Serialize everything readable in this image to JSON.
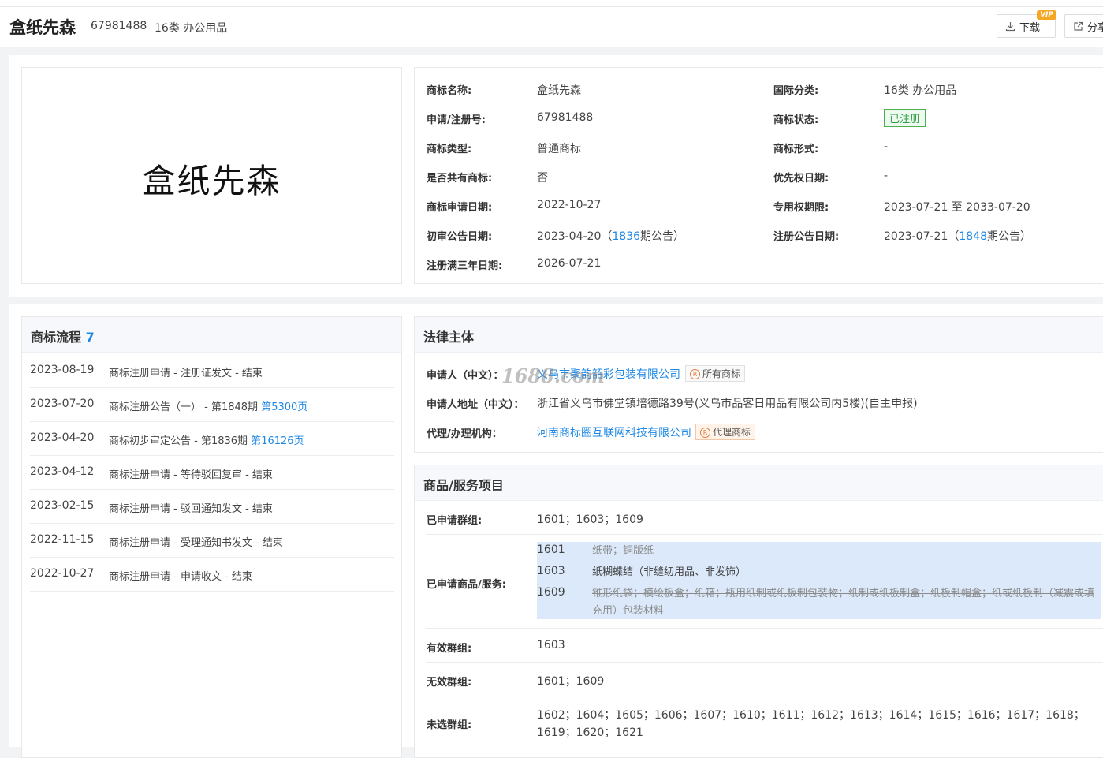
{
  "header": {
    "trademark_name": "盒纸先森",
    "reg_number": "67981488",
    "class_label": "16类 办公用品",
    "download_label": "下载",
    "vip_badge": "VIP",
    "share_label": "分享"
  },
  "logo_text": "盒纸先森",
  "info": {
    "left": [
      {
        "label": "商标名称:",
        "value": "盒纸先森"
      },
      {
        "label": "申请/注册号:",
        "value": "67981488"
      },
      {
        "label": "商标类型:",
        "value": "普通商标"
      },
      {
        "label": "是否共有商标:",
        "value": "否"
      },
      {
        "label": "商标申请日期:",
        "value": "2022-10-27"
      },
      {
        "label": "初审公告日期:",
        "value_pre": "2023-04-20（",
        "value_link": "1836",
        "value_post": "期公告）"
      },
      {
        "label": "注册满三年日期:",
        "value": "2026-07-21"
      }
    ],
    "right": [
      {
        "label": "国际分类:",
        "value": "16类 办公用品"
      },
      {
        "label": "商标状态:",
        "value": "已注册"
      },
      {
        "label": "商标形式:",
        "value": "-"
      },
      {
        "label": "优先权日期:",
        "value": "-"
      },
      {
        "label": "专用权期限:",
        "value": "2023-07-21 至 2033-07-20"
      },
      {
        "label": "注册公告日期:",
        "value_pre": "2023-07-21（",
        "value_link": "1848",
        "value_post": "期公告）"
      }
    ]
  },
  "flow": {
    "title": "商标流程",
    "count": "7",
    "rows": [
      {
        "date": "2023-08-19",
        "text": "商标注册申请 - 注册证发文 - 结束",
        "link": ""
      },
      {
        "date": "2023-07-20",
        "text": "商标注册公告（一） - 第1848期 ",
        "link": "第5300页"
      },
      {
        "date": "2023-04-20",
        "text": "商标初步审定公告 - 第1836期 ",
        "link": "第16126页"
      },
      {
        "date": "2023-04-12",
        "text": "商标注册申请 - 等待驳回复审 - 结束",
        "link": ""
      },
      {
        "date": "2023-02-15",
        "text": "商标注册申请 - 驳回通知发文 - 结束",
        "link": ""
      },
      {
        "date": "2022-11-15",
        "text": "商标注册申请 - 受理通知书发文 - 结束",
        "link": ""
      },
      {
        "date": "2022-10-27",
        "text": "商标注册申请 - 申请收文 - 结束",
        "link": ""
      }
    ]
  },
  "legal": {
    "title": "法律主体",
    "applicant_label": "申请人（中文）：",
    "applicant_value": "义乌市聚韵韶彩包装有限公司",
    "applicant_tag": "所有商标",
    "address_label": "申请人地址（中文）：",
    "address_value": "浙江省义乌市佛堂镇培德路39号(义乌市品客日用品有限公司内5楼)(自主申报)",
    "agent_label": "代理/办理机构：",
    "agent_value": "河南商标圈互联网科技有限公司",
    "agent_tag": "代理商标"
  },
  "watermark": "1688.com",
  "goods": {
    "title": "商品/服务项目",
    "groups_label": "已申请群组:",
    "groups_value": "1601；1603；1609",
    "items_label": "已申请商品/服务:",
    "items": [
      {
        "code": "1601",
        "desc": "纸带；铜版纸",
        "struck": true
      },
      {
        "code": "1603",
        "desc": "纸糊蝶结（非缝纫用品、非发饰）",
        "struck": false
      },
      {
        "code": "1609",
        "desc": "锥形纸袋；模绘板盒；纸箱；瓶用纸制或纸板制包装物；纸制或纸板制盒；纸板制帽盒；纸或纸板制（减震或填充用）包装材料",
        "struck": true
      }
    ],
    "valid_label": "有效群组:",
    "valid_value": "1603",
    "invalid_label": "无效群组:",
    "invalid_value": "1601；1609",
    "unselected_label": "未选群组:",
    "unselected_value": "1602；1604；1605；1606；1607；1610；1611；1612；1613；1614；1615；1616；1617；1618；1619；1620；1621"
  }
}
